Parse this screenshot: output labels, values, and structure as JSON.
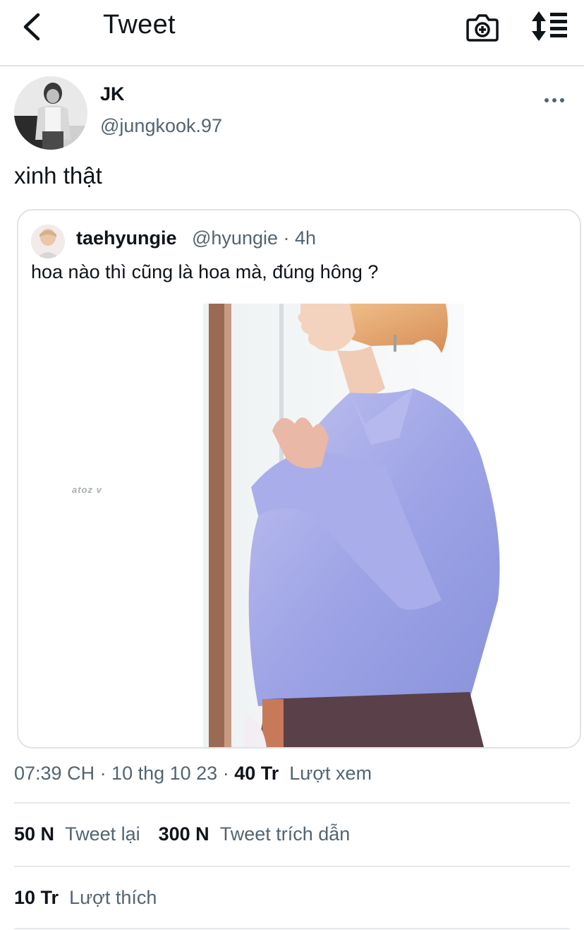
{
  "header": {
    "title": "Tweet",
    "back_icon": "chevron-left-icon",
    "camera_icon": "camera-add-icon",
    "sort_icon": "sort-list-icon"
  },
  "tweet": {
    "author_name": "JK",
    "author_handle": "@jungkook.97",
    "text": "xinh thật",
    "more_icon": "more-horizontal-icon"
  },
  "quoted_tweet": {
    "author_name": "taehyungie",
    "author_handle": "@hyungie · 4h",
    "text": "hoa nào thì cũng là hoa mà, đúng hông ?",
    "watermark": "atoz v"
  },
  "meta": {
    "time_date": "07:39 CH · 10 thg 10 23 · ",
    "views_count": "40 Tr",
    "views_label": "Lượt xem"
  },
  "stats": {
    "retweets_count": "50 N",
    "retweets_label": "Tweet lại",
    "quotes_count": "300 N",
    "quotes_label": "Tweet trích dẫn",
    "likes_count": "10 Tr",
    "likes_label": "Lượt thích"
  },
  "colors": {
    "text_primary": "#0f1419",
    "text_secondary": "#536471",
    "divider": "#e6e9eb",
    "shirt": "#9fa6e8"
  }
}
